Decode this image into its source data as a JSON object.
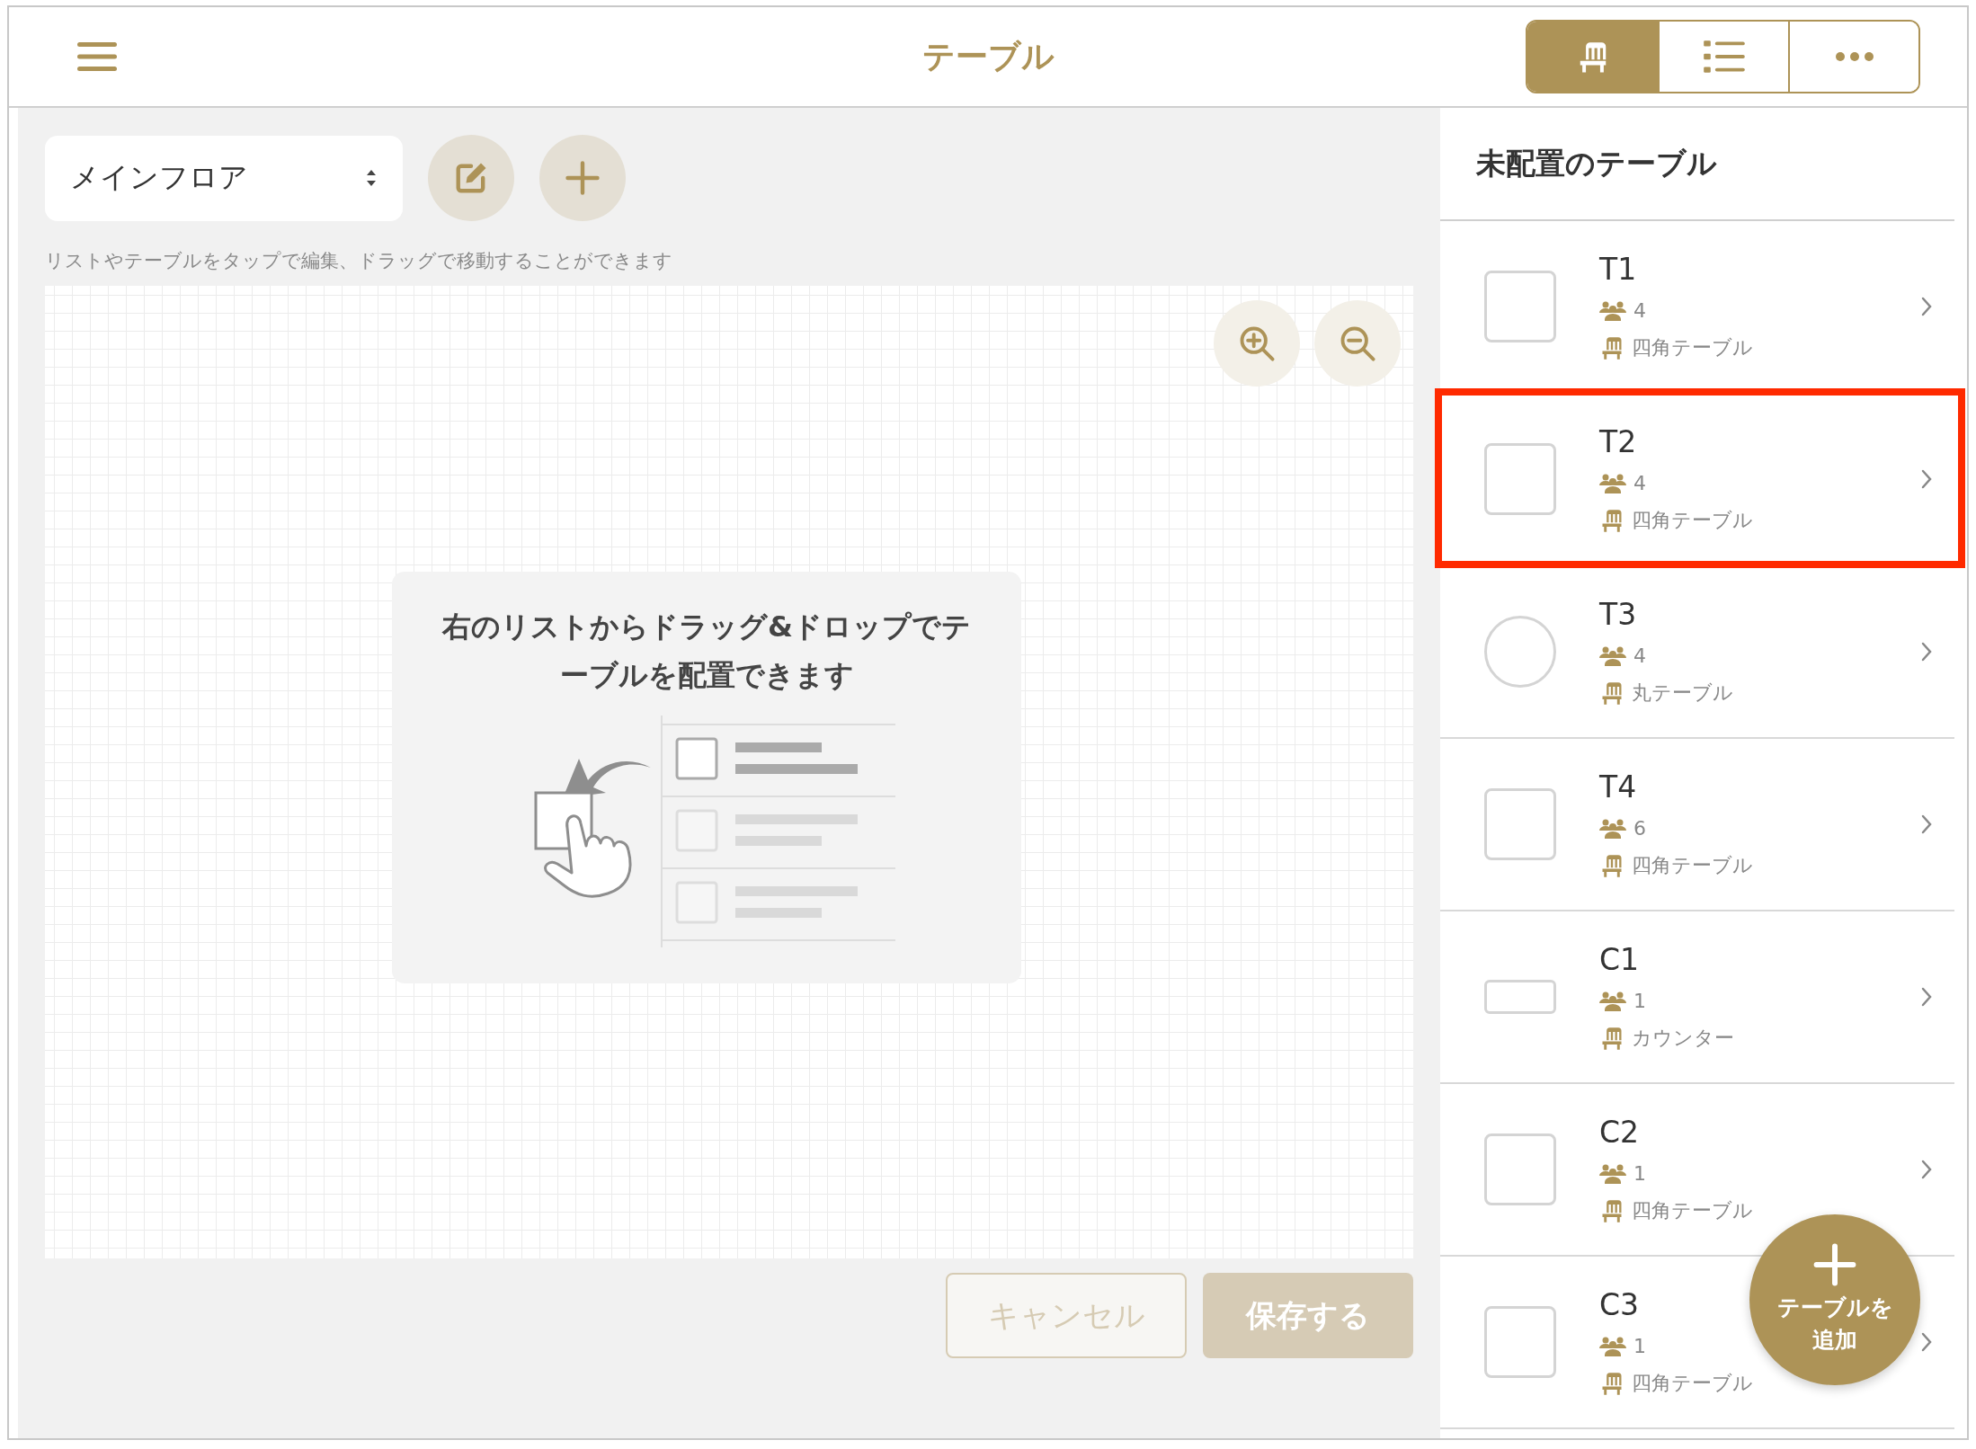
{
  "header": {
    "title": "テーブル",
    "view_tabs": [
      {
        "kind": "floor",
        "selected": true
      },
      {
        "kind": "list",
        "selected": false
      },
      {
        "kind": "more",
        "selected": false
      }
    ]
  },
  "floor_select": {
    "value": "メインフロア"
  },
  "hint": "リストやテーブルをタップで編集、ドラッグで移動することができます",
  "empty_card": {
    "message": "右のリストからドラッグ&ドロップでテーブルを配置できます"
  },
  "buttons": [
    {
      "label": "キャンセル",
      "kind": "cancel",
      "disabled": true
    },
    {
      "label": "保存する",
      "kind": "save",
      "disabled": true
    }
  ],
  "unplaced": {
    "title": "未配置のテーブル",
    "items": [
      {
        "name": "T1",
        "kind": "square",
        "seats": "4",
        "type": "四角テーブル",
        "highlighted": false
      },
      {
        "name": "T2",
        "kind": "square",
        "seats": "4",
        "type": "四角テーブル",
        "highlighted": true
      },
      {
        "name": "T3",
        "kind": "circle",
        "seats": "4",
        "type": "丸テーブル",
        "highlighted": false
      },
      {
        "name": "T4",
        "kind": "square",
        "seats": "6",
        "type": "四角テーブル",
        "highlighted": false
      },
      {
        "name": "C1",
        "kind": "wide",
        "seats": "1",
        "type": "カウンター",
        "highlighted": false
      },
      {
        "name": "C2",
        "kind": "square",
        "seats": "1",
        "type": "四角テーブル",
        "highlighted": false
      },
      {
        "name": "C3",
        "kind": "square",
        "seats": "1",
        "type": "四角テーブル",
        "highlighted": false
      }
    ]
  },
  "add_table_button": {
    "label": "テーブルを追加"
  }
}
